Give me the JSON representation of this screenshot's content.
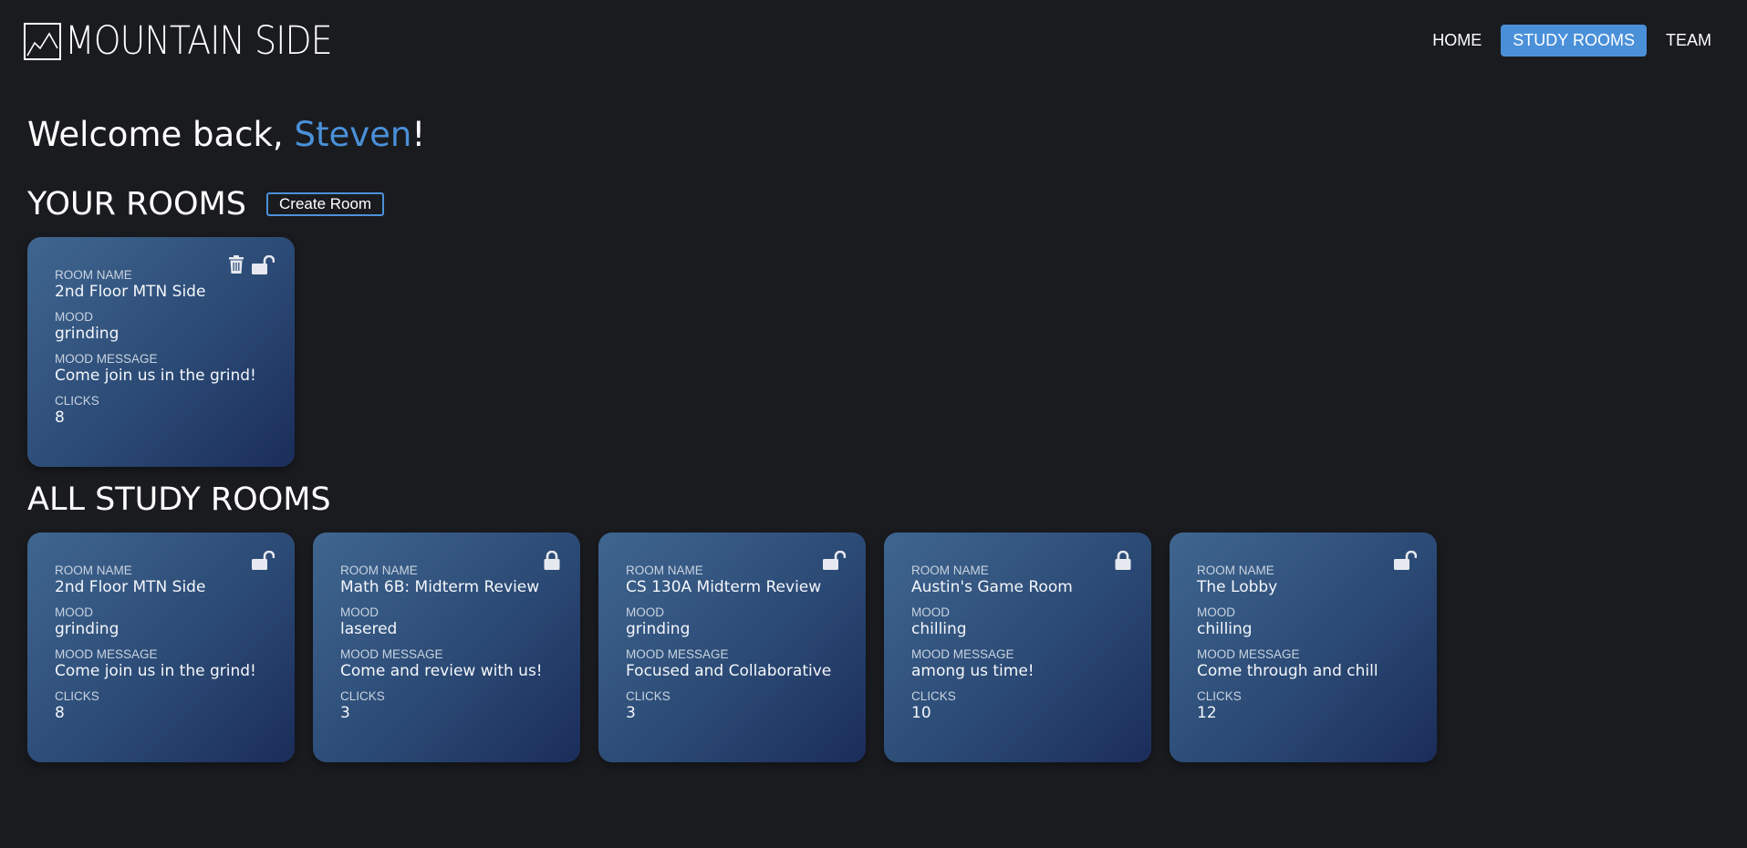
{
  "brand": {
    "name": "MOUNTAIN SIDE",
    "logo_icon": "mountain-icon"
  },
  "nav": {
    "items": [
      {
        "label": "HOME",
        "active": false
      },
      {
        "label": "STUDY ROOMS",
        "active": true
      },
      {
        "label": "TEAM",
        "active": false
      }
    ]
  },
  "welcome": {
    "prefix": "Welcome back, ",
    "user": "Steven",
    "suffix": "!"
  },
  "your_rooms": {
    "title": "YOUR ROOMS",
    "create_label": "Create Room",
    "rooms": [
      {
        "room_name_label": "ROOM NAME",
        "room_name": "2nd Floor MTN Side",
        "mood_label": "MOOD",
        "mood": "grinding",
        "mood_message_label": "MOOD MESSAGE",
        "mood_message": "Come join us in the grind!",
        "clicks_label": "CLICKS",
        "clicks": "8",
        "locked": false,
        "deletable": true
      }
    ]
  },
  "all_rooms": {
    "title": "ALL STUDY ROOMS",
    "rooms": [
      {
        "room_name_label": "ROOM NAME",
        "room_name": "2nd Floor MTN Side",
        "mood_label": "MOOD",
        "mood": "grinding",
        "mood_message_label": "MOOD MESSAGE",
        "mood_message": "Come join us in the grind!",
        "clicks_label": "CLICKS",
        "clicks": "8",
        "locked": false
      },
      {
        "room_name_label": "ROOM NAME",
        "room_name": "Math 6B: Midterm Review",
        "mood_label": "MOOD",
        "mood": "lasered",
        "mood_message_label": "MOOD MESSAGE",
        "mood_message": "Come and review with us!",
        "clicks_label": "CLICKS",
        "clicks": "3",
        "locked": true
      },
      {
        "room_name_label": "ROOM NAME",
        "room_name": "CS 130A Midterm Review",
        "mood_label": "MOOD",
        "mood": "grinding",
        "mood_message_label": "MOOD MESSAGE",
        "mood_message": "Focused and Collaborative",
        "clicks_label": "CLICKS",
        "clicks": "3",
        "locked": false
      },
      {
        "room_name_label": "ROOM NAME",
        "room_name": "Austin's Game Room",
        "mood_label": "MOOD",
        "mood": "chilling",
        "mood_message_label": "MOOD MESSAGE",
        "mood_message": "among us time!",
        "clicks_label": "CLICKS",
        "clicks": "10",
        "locked": true
      },
      {
        "room_name_label": "ROOM NAME",
        "room_name": "The Lobby",
        "mood_label": "MOOD",
        "mood": "chilling",
        "mood_message_label": "MOOD MESSAGE",
        "mood_message": "Come through and chill",
        "clicks_label": "CLICKS",
        "clicks": "12",
        "locked": false
      }
    ]
  },
  "colors": {
    "background": "#1a1b1f",
    "accent": "#4a90d9",
    "card_gradient_start": "#3f6690",
    "card_gradient_end": "#1b2d5a"
  }
}
